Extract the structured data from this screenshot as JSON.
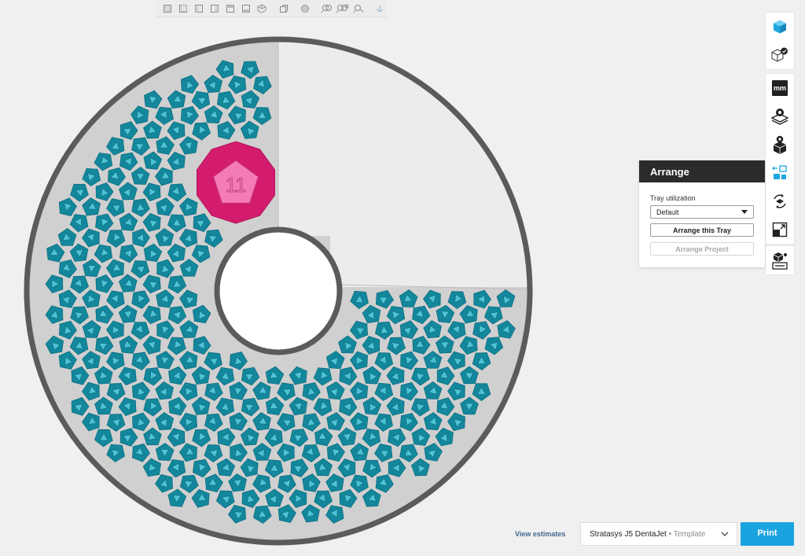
{
  "view_toolbar": {
    "buttons": [
      "front-view-icon",
      "back-view-icon",
      "left-view-icon",
      "right-view-icon",
      "top-view-icon",
      "bottom-view-icon",
      "iso-view-icon",
      "section-view-icon",
      "sphere-icon",
      "zoom-to-fit-icon",
      "zoom-all-icon",
      "zoom-selection-icon",
      "axes-icon"
    ]
  },
  "tray": {
    "ring_color": "#5b5b5b",
    "tray_color": "#d0d0d0",
    "empty_zone_color": "#ececec",
    "part_color": "#13879c",
    "selected_part_color": "#e9237e",
    "selected_part_label": "11"
  },
  "right_toolbar": {
    "group1": [
      "printer-cube-icon",
      "check-model-icon"
    ],
    "group2": [
      "units-mm-icon",
      "tray-settings-icon",
      "model-settings-icon",
      "arrange-icon",
      "orient-icon",
      "scale-icon"
    ],
    "group3": [
      "support-icon"
    ],
    "units_label": "mm"
  },
  "arrange_panel": {
    "title": "Arrange",
    "tray_utilization_label": "Tray utilization",
    "tray_utilization_value": "Default",
    "arrange_tray_label": "Arrange this Tray",
    "arrange_project_label": "Arrange Project"
  },
  "bottom_bar": {
    "view_estimates_label": "View estimates",
    "printer_name": "Stratasys J5 DentaJet",
    "printer_template": "Template",
    "print_label": "Print",
    "accent_color": "#1ba3e0"
  }
}
